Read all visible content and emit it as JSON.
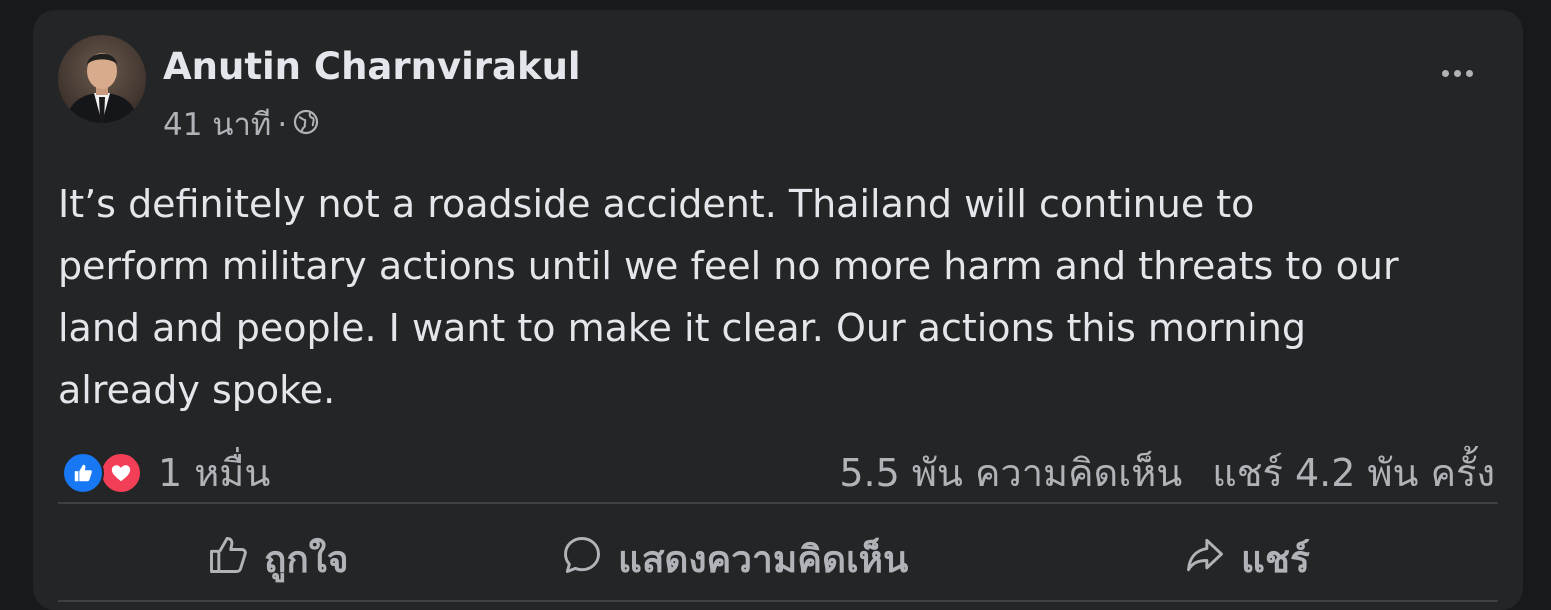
{
  "post": {
    "author": "Anutin Charnvirakul",
    "time": "41 นาที",
    "separator": "·",
    "privacy_icon": "globe-icon",
    "more_icon": "more-options-icon",
    "text_lines": [
      "It’s definitely not a roadside accident. Thailand will continue to",
      "perform military actions until we feel no more harm and threats to our",
      "land and people. I want to make it clear. Our actions this morning",
      "already spoke."
    ]
  },
  "stats": {
    "reaction_icons": [
      "like-icon",
      "love-icon"
    ],
    "reactions": "1 หมื่น",
    "comments": "5.5 พัน ความคิดเห็น",
    "shares": "แชร์ 4.2 พัน ครั้ง"
  },
  "actions": {
    "like": "ถูกใจ",
    "comment": "แสดงความคิดเห็น",
    "share": "แชร์"
  },
  "colors": {
    "background": "#18191a",
    "card": "#242526",
    "primary_text": "#e4e6eb",
    "secondary_text": "#b0b3b8",
    "like_blue": "#1877f2",
    "love_red": "#f33e58"
  }
}
